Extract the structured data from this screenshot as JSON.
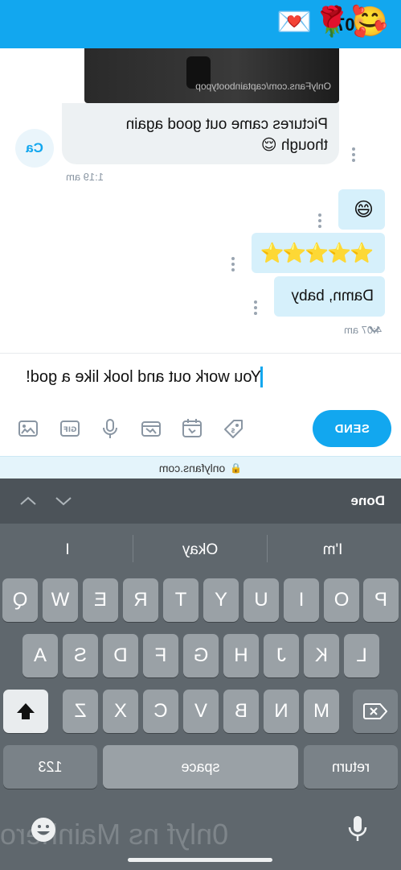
{
  "status_bar": {
    "time": "4:07",
    "emojis": "🥰🌹💌"
  },
  "chat": {
    "media_watermark": "OnlyFans.com/captainbootypop",
    "incoming_message": "Pictures came out good again though 😌",
    "avatar_initials": "Ca",
    "incoming_time": "1:19 am",
    "outgoing_messages": [
      "😄",
      "⭐⭐⭐⭐⭐",
      "Damn, baby"
    ],
    "outgoing_time": "4:07 am"
  },
  "composer": {
    "input_value": "You work out and look like a god!",
    "send_label": "SEND",
    "tools": [
      "image-icon",
      "gif-icon",
      "microphone-icon",
      "vault-icon",
      "schedule-icon",
      "price-tag-icon"
    ]
  },
  "url_bar": {
    "domain": "onlyfans.com"
  },
  "keyboard_accessory": {
    "done_label": "Done"
  },
  "keyboard": {
    "suggestions": [
      "I",
      "Okay",
      "I'm"
    ],
    "row1": [
      "Q",
      "W",
      "E",
      "R",
      "T",
      "Y",
      "U",
      "I",
      "O",
      "P"
    ],
    "row2": [
      "A",
      "S",
      "D",
      "F",
      "G",
      "H",
      "J",
      "K",
      "L"
    ],
    "row3": [
      "Z",
      "X",
      "C",
      "V",
      "B",
      "N",
      "M"
    ],
    "numbers_label": "123",
    "space_label": "space",
    "return_label": "return",
    "watermark": "0nlyf ns Mainhero"
  },
  "colors": {
    "accent": "#12a7ef",
    "out_bubble": "#d6f0fb",
    "in_bubble": "#edf1f3",
    "keyboard_bg": "#5f676d"
  }
}
